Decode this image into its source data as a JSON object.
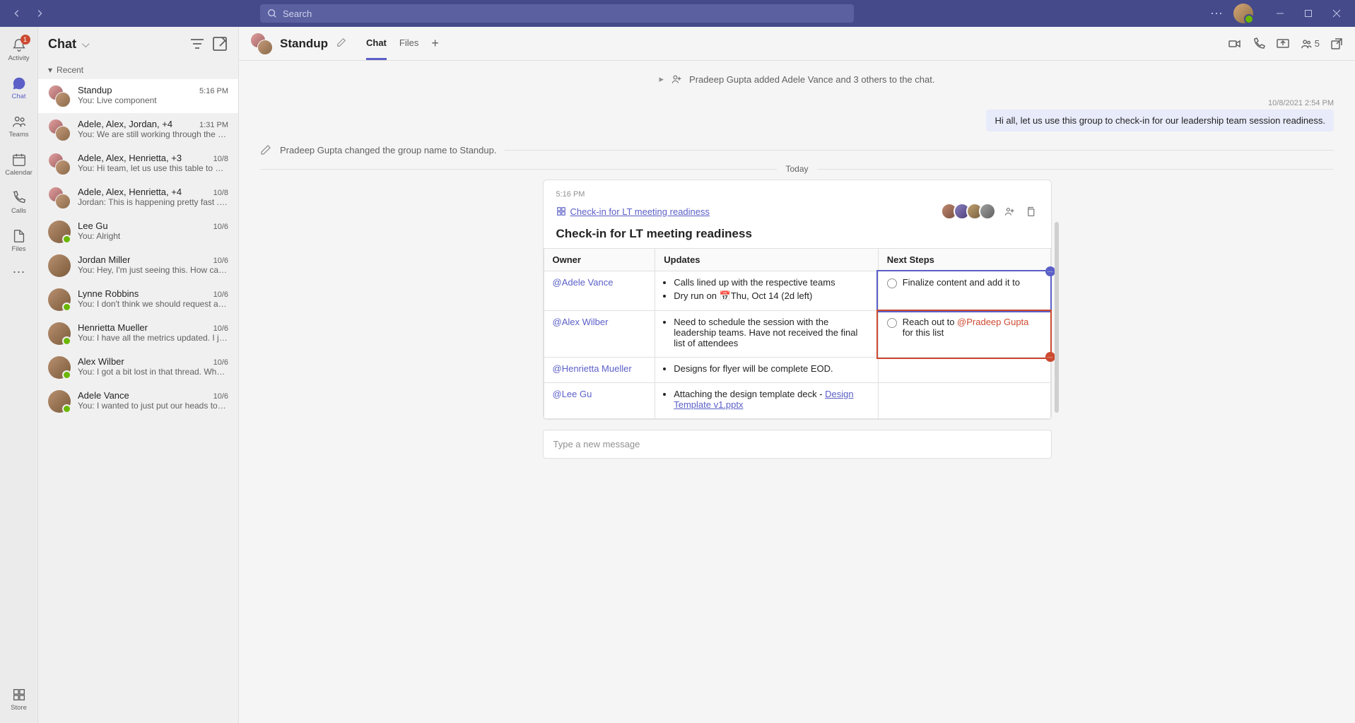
{
  "search_placeholder": "Search",
  "rail": {
    "activity": "Activity",
    "activity_badge": "1",
    "chat": "Chat",
    "teams": "Teams",
    "calendar": "Calendar",
    "calls": "Calls",
    "files": "Files",
    "store": "Store"
  },
  "chatlist": {
    "title": "Chat",
    "section": "Recent",
    "items": [
      {
        "name": "Standup",
        "time": "5:16 PM",
        "preview": "You: Live component",
        "group": true,
        "active": true
      },
      {
        "name": "Adele, Alex, Jordan, +4",
        "time": "1:31 PM",
        "preview": "You: We are still working through the details, b...",
        "group": true
      },
      {
        "name": "Adele, Alex, Henrietta, +3",
        "time": "10/8",
        "preview": "You: Hi team, let us use this table to provide upd...",
        "group": true
      },
      {
        "name": "Adele, Alex, Henrietta, +4",
        "time": "10/8",
        "preview": "Jordan: This is happening pretty fast ... can some...",
        "group": true
      },
      {
        "name": "Lee Gu",
        "time": "10/6",
        "preview": "You: Alright",
        "presence": true
      },
      {
        "name": "Jordan Miller",
        "time": "10/6",
        "preview": "You: Hey, I'm just seeing this. How can I help? W..."
      },
      {
        "name": "Lynne Robbins",
        "time": "10/6",
        "preview": "You: I don't think we should request agency bud...",
        "presence": true
      },
      {
        "name": "Henrietta Mueller",
        "time": "10/6",
        "preview": "You: I have all the metrics updated. I just need th...",
        "presence": true
      },
      {
        "name": "Alex Wilber",
        "time": "10/6",
        "preview": "You: I got a bit lost in that thread. When is this pr...",
        "presence": true
      },
      {
        "name": "Adele Vance",
        "time": "10/6",
        "preview": "You: I wanted to just put our heads together and...",
        "presence": true
      }
    ]
  },
  "header": {
    "title": "Standup",
    "tabs": {
      "chat": "Chat",
      "files": "Files"
    },
    "people_count": "5"
  },
  "system": {
    "added": "Pradeep Gupta added Adele Vance and 3 others to the chat.",
    "renamed": "Pradeep Gupta changed the group name to Standup.",
    "today": "Today"
  },
  "message": {
    "meta": "10/8/2021 2:54 PM",
    "text": "Hi all, let us use this group to check-in for our leadership team session readiness."
  },
  "loop": {
    "time": "5:16 PM",
    "link": "Check-in for LT meeting readiness",
    "title": "Check-in for LT meeting readiness",
    "columns": {
      "owner": "Owner",
      "updates": "Updates",
      "next": "Next Steps"
    },
    "rows": [
      {
        "owner": "@Adele Vance",
        "updates": [
          "Calls lined up with the respective teams",
          "Dry run on 📅Thu, Oct 14 (2d left)"
        ],
        "next": "Finalize content and add it to",
        "selected": "blue"
      },
      {
        "owner": "@Alex Wilber",
        "updates": [
          "Need to schedule the session with the leadership teams. Have not received the final list of attendees"
        ],
        "next_prefix": "Reach out to ",
        "next_mention": "@Pradeep Gupta",
        "next_suffix": " for this list",
        "selected": "red"
      },
      {
        "owner": "@Henrietta Mueller",
        "updates": [
          "Designs for flyer will be complete EOD."
        ]
      },
      {
        "owner": "@Lee Gu",
        "updates_prefix": "Attaching the design template deck - ",
        "updates_link": "Design Template v1.pptx"
      }
    ]
  },
  "compose_placeholder": "Type a new message"
}
